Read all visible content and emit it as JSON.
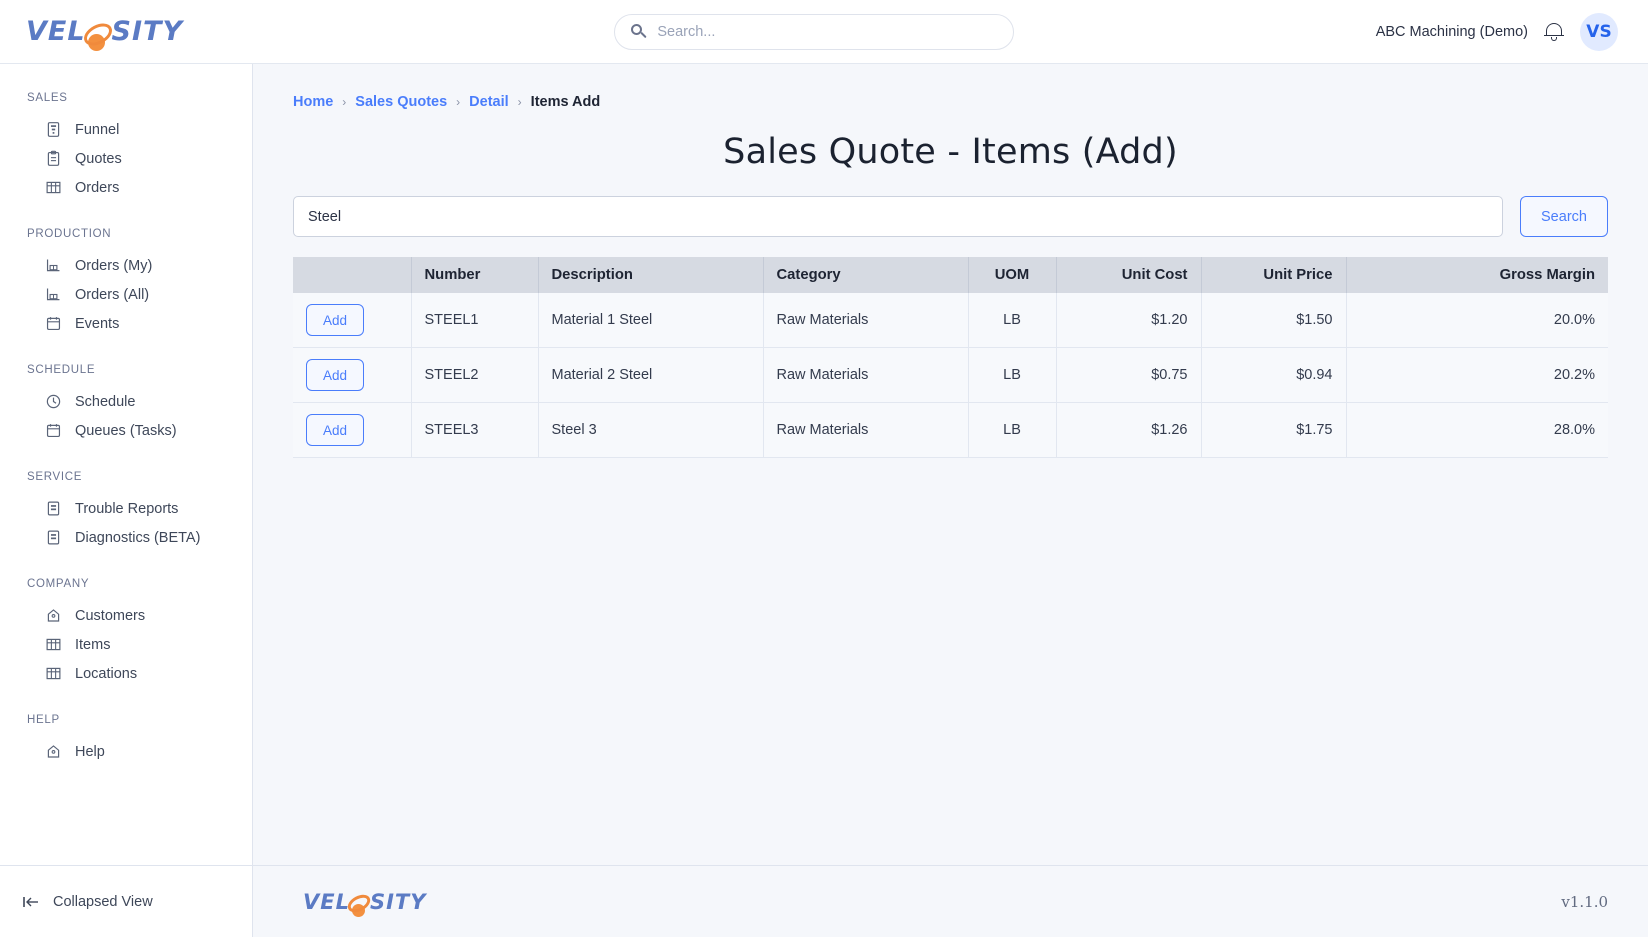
{
  "brand": {
    "name_part1": "VEL",
    "name_part2": "SITY",
    "logo_accent": "#f3903f",
    "logo_color": "#5b7bc4"
  },
  "header": {
    "search_placeholder": "Search...",
    "search_value": "",
    "company": "ABC Machining (Demo)",
    "avatar_initials": "VS",
    "accent": "#2563eb"
  },
  "sidebar": {
    "sections": [
      {
        "title": "SALES",
        "items": [
          {
            "label": "Funnel",
            "icon": "funnel-chart-icon"
          },
          {
            "label": "Quotes",
            "icon": "clipboard-icon"
          },
          {
            "label": "Orders",
            "icon": "table-icon"
          }
        ]
      },
      {
        "title": "PRODUCTION",
        "items": [
          {
            "label": "Orders (My)",
            "icon": "factory-icon"
          },
          {
            "label": "Orders (All)",
            "icon": "factory-icon"
          },
          {
            "label": "Events",
            "icon": "calendar-icon"
          }
        ]
      },
      {
        "title": "SCHEDULE",
        "items": [
          {
            "label": "Schedule",
            "icon": "clock-icon"
          },
          {
            "label": "Queues (Tasks)",
            "icon": "calendar-icon"
          }
        ]
      },
      {
        "title": "SERVICE",
        "items": [
          {
            "label": "Trouble Reports",
            "icon": "report-icon"
          },
          {
            "label": "Diagnostics (BETA)",
            "icon": "report-icon"
          }
        ]
      },
      {
        "title": "COMPANY",
        "items": [
          {
            "label": "Customers",
            "icon": "home-icon"
          },
          {
            "label": "Items",
            "icon": "table-icon"
          },
          {
            "label": "Locations",
            "icon": "table-icon"
          }
        ]
      },
      {
        "title": "HELP",
        "items": [
          {
            "label": "Help",
            "icon": "home-icon"
          }
        ]
      }
    ],
    "collapse_label": "Collapsed View"
  },
  "breadcrumb": {
    "items": [
      {
        "label": "Home",
        "link": true
      },
      {
        "label": "Sales Quotes",
        "link": true
      },
      {
        "label": "Detail",
        "link": true
      },
      {
        "label": "Items Add",
        "link": false
      }
    ],
    "separator": "›"
  },
  "page": {
    "title": "Sales Quote - Items (Add)",
    "search_value": "Steel",
    "search_placeholder": "",
    "search_button": "Search"
  },
  "table": {
    "columns": [
      "",
      "Number",
      "Description",
      "Category",
      "UOM",
      "Unit Cost",
      "Unit Price",
      "Gross Margin"
    ],
    "row_action_label": "Add",
    "rows": [
      {
        "action": "Add",
        "number": "STEEL1",
        "description": "Material 1 Steel",
        "category": "Raw Materials",
        "uom": "LB",
        "unit_cost": "$1.20",
        "unit_price": "$1.50",
        "gross_margin": "20.0%"
      },
      {
        "action": "Add",
        "number": "STEEL2",
        "description": "Material 2 Steel",
        "category": "Raw Materials",
        "uom": "LB",
        "unit_cost": "$0.75",
        "unit_price": "$0.94",
        "gross_margin": "20.2%"
      },
      {
        "action": "Add",
        "number": "STEEL3",
        "description": "Steel 3",
        "category": "Raw Materials",
        "uom": "LB",
        "unit_cost": "$1.26",
        "unit_price": "$1.75",
        "gross_margin": "28.0%"
      }
    ]
  },
  "footer": {
    "version": "v1.1.0"
  }
}
